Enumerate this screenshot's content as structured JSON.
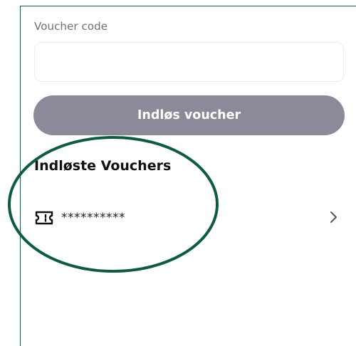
{
  "voucher_form": {
    "label": "Voucher code",
    "value": "",
    "placeholder": "",
    "button_label": "Indløs voucher"
  },
  "redeemed": {
    "title": "Indløste Vouchers",
    "items": [
      {
        "icon": "ticket-icon",
        "code": "**********"
      }
    ]
  },
  "colors": {
    "frame_border": "#1f5a47",
    "annotation": "#0f5a45",
    "button_bg": "#8a8a99",
    "button_text": "#ffffff"
  }
}
